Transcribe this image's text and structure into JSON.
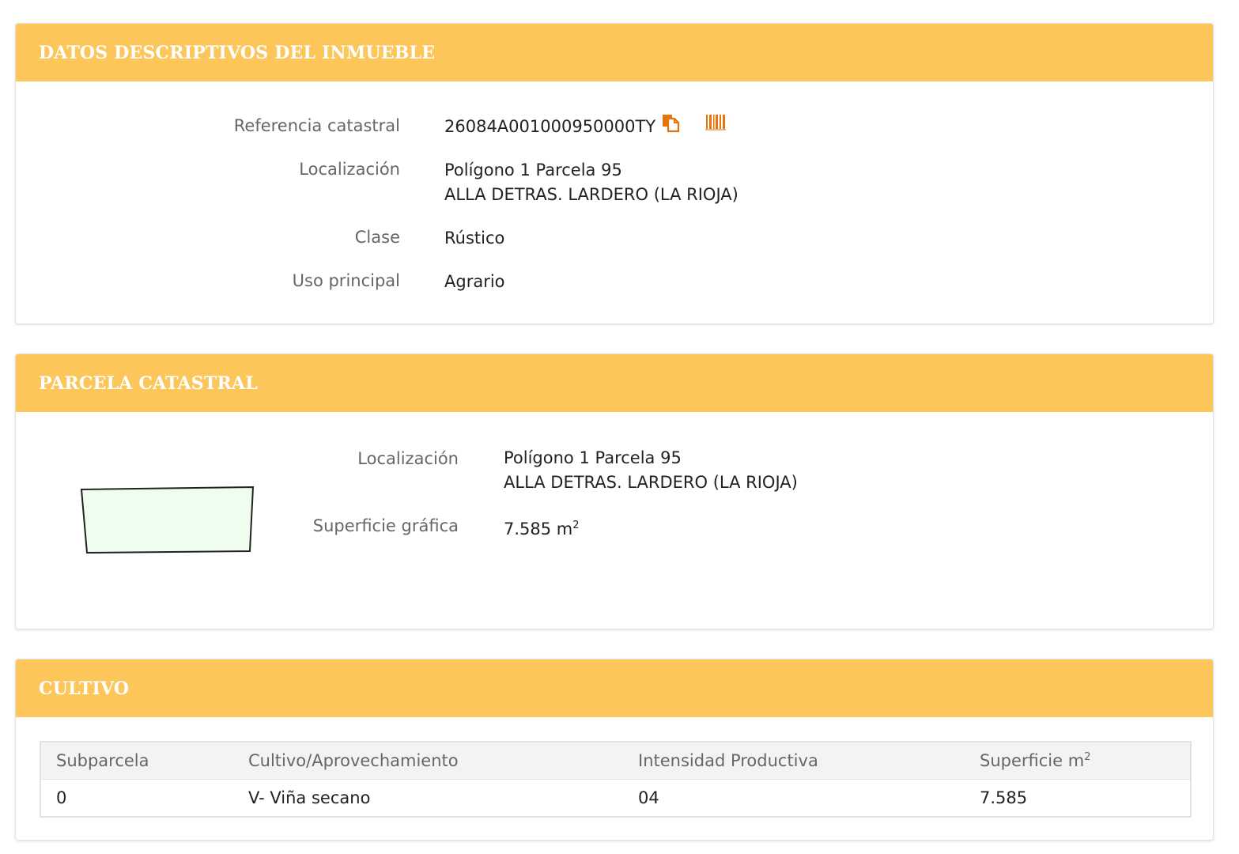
{
  "datos": {
    "title": "DATOS DESCRIPTIVOS DEL INMUEBLE",
    "ref_label": "Referencia catastral",
    "ref_value": "26084A001000950000TY",
    "copy_icon": "copy-icon",
    "barcode_icon": "barcode-icon",
    "loc_label": "Localización",
    "loc_line1": "Polígono 1 Parcela 95",
    "loc_line2": "ALLA DETRAS. LARDERO (LA RIOJA)",
    "clase_label": "Clase",
    "clase_value": "Rústico",
    "uso_label": "Uso principal",
    "uso_value": "Agrario"
  },
  "parcela": {
    "title": "PARCELA CATASTRAL",
    "loc_label": "Localización",
    "loc_line1": "Polígono 1 Parcela 95",
    "loc_line2": "ALLA DETRAS. LARDERO (LA RIOJA)",
    "sup_label": "Superficie gráfica",
    "sup_value": "7.585 m",
    "sup_exp": "2"
  },
  "cultivo": {
    "title": "CULTIVO",
    "headers": [
      "Subparcela",
      "Cultivo/Aprovechamiento",
      "Intensidad Productiva",
      "Superficie m"
    ],
    "header_sup": "2",
    "rows": [
      [
        "0",
        "V- Viña secano",
        "04",
        "7.585"
      ]
    ]
  },
  "colors": {
    "header_bg": "#fcc65a",
    "icon_orange": "#e8730c",
    "parcel_fill": "#eefdee"
  }
}
